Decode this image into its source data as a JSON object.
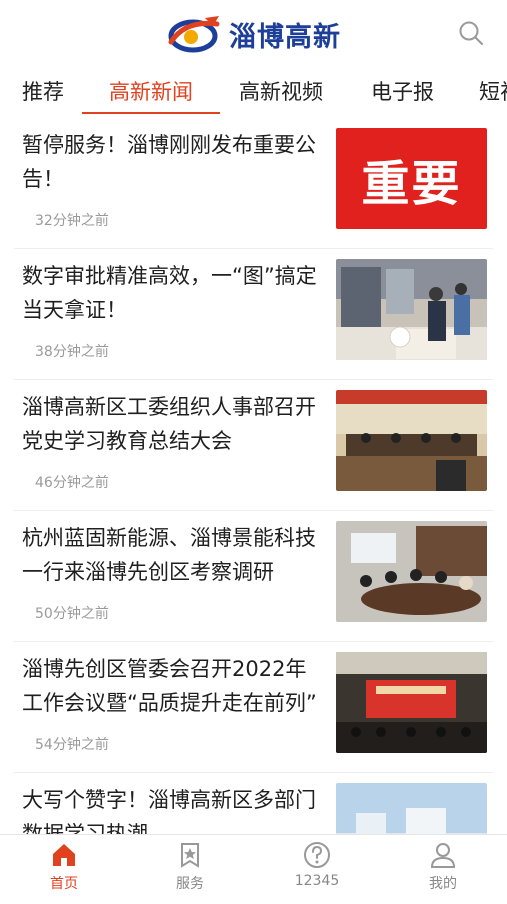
{
  "header": {
    "logo_text": "淄博高新",
    "brand_color": "#1d3f9a",
    "search_icon": "search-icon"
  },
  "tabs": [
    {
      "label": "推荐"
    },
    {
      "label": "高新新闻",
      "active": true
    },
    {
      "label": "高新视频"
    },
    {
      "label": "电子报"
    },
    {
      "label": "短视"
    }
  ],
  "accent_color": "#e0421f",
  "news": [
    {
      "title": "暂停服务！淄博刚刚发布重要公告！",
      "time": "32分钟之前",
      "thumb_text": "重要"
    },
    {
      "title": "数字审批精准高效，一“图”搞定当天拿证！",
      "time": "38分钟之前"
    },
    {
      "title": "淄博高新区工委组织人事部召开党史学习教育总结大会",
      "time": "46分钟之前"
    },
    {
      "title": "杭州蓝固新能源、淄博景能科技一行来淄博先创区考察调研",
      "time": "50分钟之前"
    },
    {
      "title": "淄博先创区管委会召开2022年工作会议暨“品质提升走在前列”",
      "time": "54分钟之前"
    },
    {
      "title": "大写个赞字！淄博高新区多部门数据学习热潮",
      "time": ""
    }
  ],
  "bottom_nav": [
    {
      "label": "首页",
      "icon": "home-icon",
      "active": true
    },
    {
      "label": "服务",
      "icon": "bookmark-star-icon"
    },
    {
      "label": "12345",
      "icon": "help-circle-icon"
    },
    {
      "label": "我的",
      "icon": "user-icon"
    }
  ]
}
